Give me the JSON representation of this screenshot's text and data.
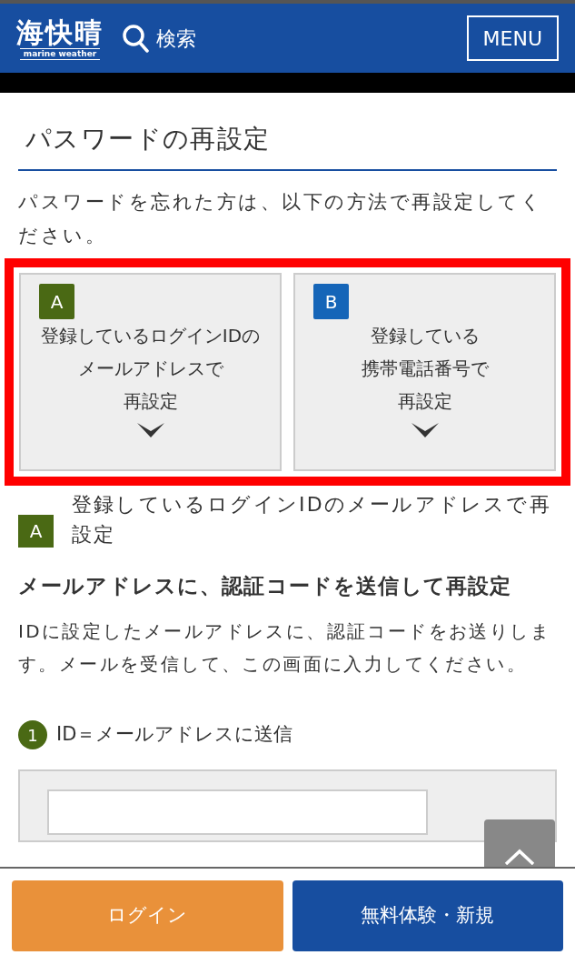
{
  "header": {
    "logo": "海快晴",
    "logo_sub": "marine weather",
    "search": "検索",
    "menu": "MENU"
  },
  "page_title": "パスワードの再設定",
  "intro": "パスワードを忘れた方は、以下の方法で再設定してください。",
  "options": [
    {
      "badge": "A",
      "color": "#4a6914",
      "lines": [
        "登録しているログインIDの",
        "メールアドレスで",
        "再設定"
      ]
    },
    {
      "badge": "B",
      "color": "#1565b8",
      "lines": [
        "登録している",
        "携帯電話番号で",
        "再設定"
      ]
    }
  ],
  "section": {
    "badge": "A",
    "color": "#4a6914",
    "title": "登録しているログインIDのメールアドレスで再設定"
  },
  "subheading": "メールアドレスに、認証コードを送信して再設定",
  "description": "IDに設定したメールアドレスに、認証コードをお送りします。メールを受信して、この画面に入力してください。",
  "step": {
    "number": "1",
    "label": "ID＝メールアドレスに送信"
  },
  "buttons": [
    {
      "label": "ログイン",
      "kind": "login"
    },
    {
      "label": "無料体験・新規",
      "kind": "signup"
    }
  ]
}
